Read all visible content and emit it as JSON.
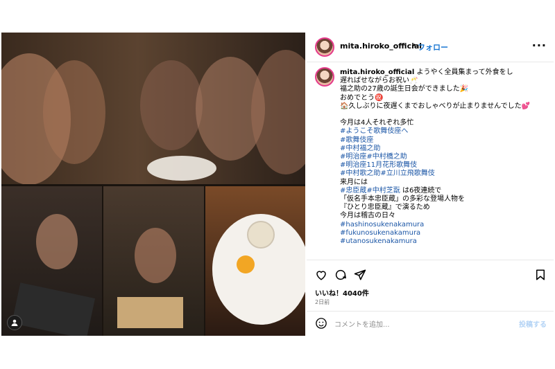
{
  "header": {
    "username": "mita.hiroko_official",
    "separator": "•",
    "follow": "フォロー",
    "more": "···"
  },
  "caption": {
    "username": "mita.hiroko_official",
    "first_line": " ようやく全員集まって外食をし",
    "lines": [
      "遅ればせながらお祝い🥂",
      "福之助の27歳の誕生日会ができました🎉",
      "おめでとう㊗️",
      "🏠久しぶりに夜遅くまでおしゃべりが止まりませんでした💕",
      "",
      "今月は4人それぞれ多忙"
    ],
    "tags1": [
      "#ようこそ歌舞伎座へ",
      "#歌舞伎座",
      "#中村福之助",
      "#明治座#中村橋之助",
      "#明治座11月花形歌舞伎",
      "#中村歌之助#立川立飛歌舞伎"
    ],
    "next_month": "来月には",
    "tag_line_tag": "#忠臣蔵#中村芝翫",
    "tag_line_text": " は6夜連続で",
    "lines2": [
      "「仮名手本忠臣蔵」の多彩な登場人物を",
      "『ひとり忠臣蔵』で演るため",
      "今月は稽古の日々"
    ],
    "tags2": [
      "#hashinosukenakamura",
      "#fukunosukenakamura",
      "#utanosukenakamura"
    ]
  },
  "icons": [
    "heart-icon",
    "comment-icon",
    "share-icon",
    "bookmark-icon",
    "emoji-icon",
    "user-tag-icon"
  ],
  "likes": "いいね！4040件",
  "date": "2日前",
  "comment": {
    "placeholder": "コメントを追加...",
    "post": "投稿する"
  }
}
